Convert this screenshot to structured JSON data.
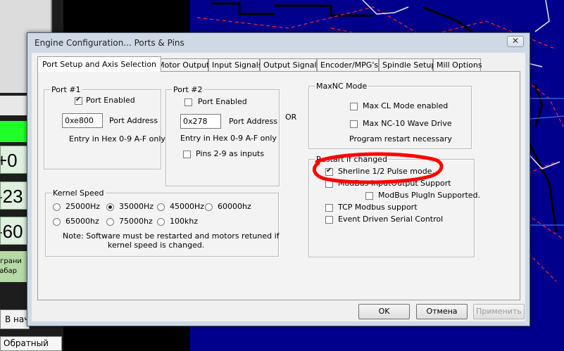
{
  "background_app": {
    "dro_values": [
      "+0",
      "-23",
      "-60"
    ],
    "ru_lines": [
      "ограни",
      "габар"
    ],
    "home_button": "В нач",
    "reverse_button": "Обратный"
  },
  "dialog": {
    "title": "Engine Configuration... Ports & Pins",
    "close_glyph": "✕",
    "tabs": [
      "Port Setup and Axis Selection",
      "Motor Outputs",
      "Input Signals",
      "Output Signals",
      "Encoder/MPG's",
      "Spindle Setup",
      "Mill Options"
    ],
    "port1": {
      "legend": "Port #1",
      "enabled_label": "Port Enabled",
      "enabled": true,
      "address_value": "0xe800",
      "address_label": "Port Address",
      "hint": "Entry in Hex 0-9 A-F only"
    },
    "port2": {
      "legend": "Port #2",
      "enabled_label": "Port Enabled",
      "enabled": false,
      "address_value": "0x278",
      "address_label": "Port Address",
      "hint": "Entry in Hex 0-9 A-F only",
      "pins_label": "Pins 2-9 as inputs",
      "pins_checked": false
    },
    "or_label": "OR",
    "maxnc": {
      "legend": "MaxNC Mode",
      "cl_mode_label": "Max CL Mode enabled",
      "nc10_label": "Max NC-10 Wave Drive",
      "restart_note": "Program restart necessary"
    },
    "restart_group": {
      "legend": "Restart if changed",
      "sherline_label": "Sherline 1/2 Pulse mode.",
      "sherline_checked": true,
      "modbus_io_label": "ModBus InputOutput Support",
      "modbus_plugin_label": "ModBus PlugIn Supported.",
      "tcp_label": "TCP Modbus support",
      "event_label": "Event Driven Serial Control"
    },
    "kernel": {
      "legend": "Kernel Speed",
      "options": [
        "25000Hz",
        "35000Hz",
        "45000Hz",
        "60000hz",
        "65000hz",
        "75000hz",
        "100khz"
      ],
      "selected": "35000Hz",
      "note_line1": "Note: Software must be restarted and motors retuned if",
      "note_line2": "kernel speed is changed."
    },
    "buttons": {
      "ok": "OK",
      "cancel": "Отмена",
      "apply": "Применить"
    }
  },
  "colors": {
    "cad_background": "#00008c",
    "annotation": "#ff0000",
    "dro_green": "#21ff28"
  }
}
